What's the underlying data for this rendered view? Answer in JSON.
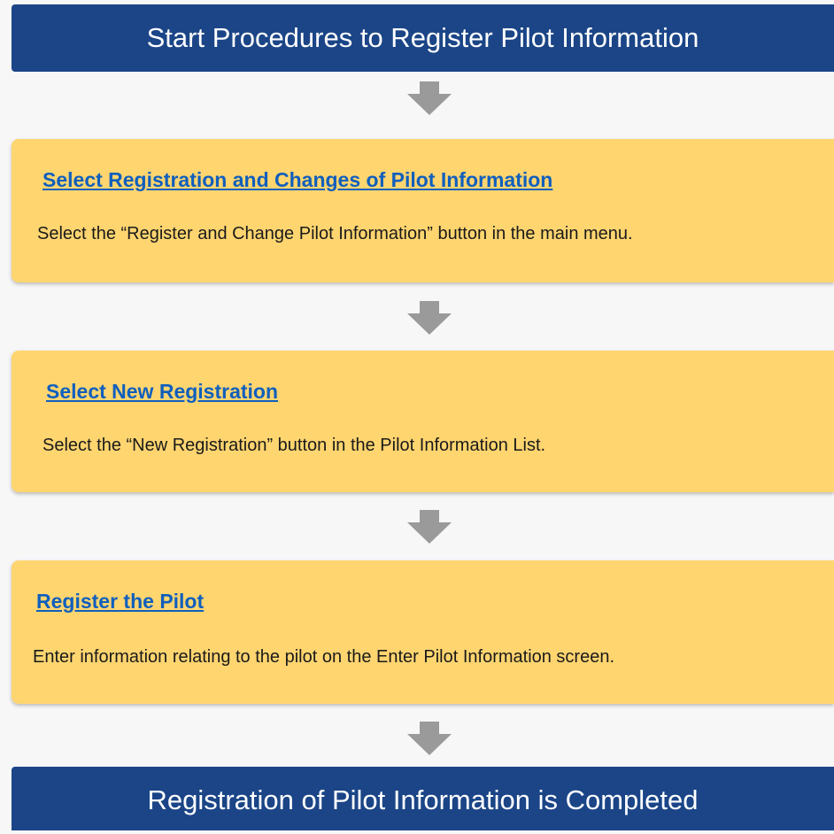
{
  "start_banner": "Start Procedures to Register Pilot Information",
  "end_banner": "Registration of Pilot Information is Completed",
  "steps": [
    {
      "title": "Select Registration and Changes of Pilot Information",
      "description": "Select the “Register and Change Pilot Information” button in the main menu."
    },
    {
      "title": "Select New Registration",
      "description": "Select the “New Registration” button in the Pilot Information List."
    },
    {
      "title": "Register the Pilot",
      "description": "Enter information relating to the pilot on the Enter Pilot Information screen."
    }
  ],
  "colors": {
    "banner": "#1b4587",
    "step_box": "#ffd570",
    "link": "#0f5fbd",
    "arrow": "#9a9a9a"
  },
  "icons": [
    "arrow-down-icon"
  ]
}
